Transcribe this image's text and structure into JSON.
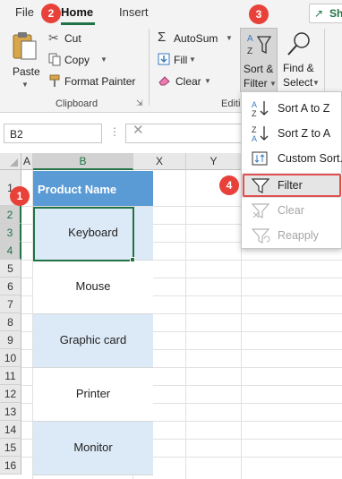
{
  "tabs": {
    "file": "File",
    "home": "Home",
    "insert": "Insert",
    "share": "Sh"
  },
  "ribbon": {
    "paste_label": "Paste",
    "cut_label": "Cut",
    "copy_label": "Copy",
    "format_painter_label": "Format Painter",
    "clipboard_group": "Clipboard",
    "autosum_label": "AutoSum",
    "fill_label": "Fill",
    "clear_label": "Clear",
    "editing_group": "Editi",
    "sort_filter_line1": "Sort &",
    "sort_filter_line2": "Filter",
    "find_select_line1": "Find &",
    "find_select_line2": "Select"
  },
  "formula_bar": {
    "name_box": "B2",
    "value": ""
  },
  "columns": [
    "A",
    "B",
    "X",
    "Y"
  ],
  "rows": [
    "1",
    "2",
    "3",
    "4",
    "5",
    "6",
    "7",
    "8",
    "9",
    "10",
    "11",
    "12",
    "13",
    "14",
    "15",
    "16"
  ],
  "table": {
    "header": "Product Name",
    "items": [
      "Keyboard",
      "Mouse",
      "Graphic card",
      "Printer",
      "Monitor"
    ]
  },
  "sort_menu": {
    "items": [
      {
        "label": "Sort A to Z",
        "icon": "sort-a-to-z-icon",
        "enabled": true
      },
      {
        "label": "Sort Z to A",
        "icon": "sort-z-to-a-icon",
        "enabled": true
      },
      {
        "label": "Custom Sort...",
        "icon": "custom-sort-icon",
        "enabled": true
      },
      {
        "label": "Filter",
        "icon": "filter-icon",
        "enabled": true
      },
      {
        "label": "Clear",
        "icon": "clear-filter-icon",
        "enabled": false
      },
      {
        "label": "Reapply",
        "icon": "reapply-filter-icon",
        "enabled": false
      }
    ]
  },
  "steps": [
    "1",
    "2",
    "3",
    "4"
  ],
  "colors": {
    "accent": "#217346",
    "header_fill": "#5b9bd5",
    "band_fill": "#dce9f6",
    "badge": "#e8413a"
  }
}
